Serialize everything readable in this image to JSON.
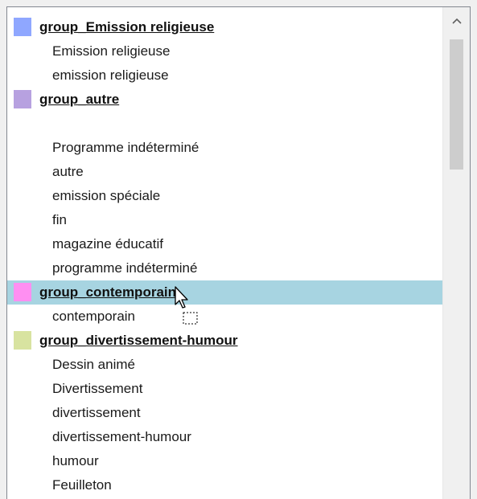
{
  "listbox": {
    "rows": [
      {
        "kind": "group",
        "label": "group_Emission religieuse",
        "color": "#8fa7ff",
        "selected": false
      },
      {
        "kind": "item",
        "label": "Emission religieuse"
      },
      {
        "kind": "item",
        "label": "emission religieuse"
      },
      {
        "kind": "group",
        "label": "group_autre",
        "color": "#b7a1e0",
        "selected": false
      },
      {
        "kind": "item",
        "label": ""
      },
      {
        "kind": "item",
        "label": "Programme indéterminé"
      },
      {
        "kind": "item",
        "label": "autre"
      },
      {
        "kind": "item",
        "label": "emission spéciale"
      },
      {
        "kind": "item",
        "label": "fin"
      },
      {
        "kind": "item",
        "label": "magazine éducatif"
      },
      {
        "kind": "item",
        "label": "programme indéterminé"
      },
      {
        "kind": "group",
        "label": "group_contemporain",
        "color": "#ff8ff2",
        "selected": true
      },
      {
        "kind": "item",
        "label": "contemporain"
      },
      {
        "kind": "group",
        "label": "group_divertissement-humour",
        "color": "#d8e3a0",
        "selected": false
      },
      {
        "kind": "item",
        "label": "Dessin animé"
      },
      {
        "kind": "item",
        "label": "Divertissement"
      },
      {
        "kind": "item",
        "label": "divertissement"
      },
      {
        "kind": "item",
        "label": "divertissement-humour"
      },
      {
        "kind": "item",
        "label": "humour"
      },
      {
        "kind": "item",
        "label": "Feuilleton"
      }
    ]
  },
  "colors": {
    "selection": "#a7d4e1",
    "scroll_thumb": "#cdcdcd"
  },
  "icons": {
    "scroll_up": "chevron-up-icon",
    "cursor": "drag-copy-cursor-icon"
  }
}
